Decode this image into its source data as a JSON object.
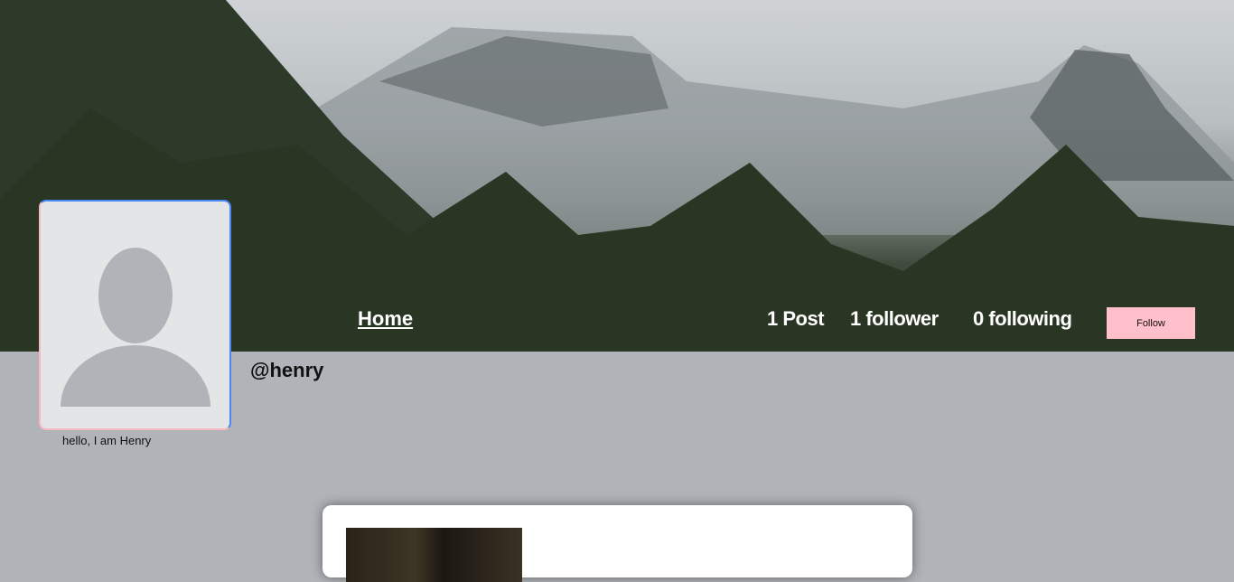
{
  "nav": {
    "home_label": "Home"
  },
  "stats": {
    "posts": "1 Post",
    "followers": "1 follower",
    "following": "0 following"
  },
  "follow_label": "Follow",
  "profile": {
    "handle": "@henry",
    "bio": "hello, I am Henry"
  },
  "colors": {
    "page_bg": "#b0b3b8",
    "follow_button": "#ffc0cb",
    "avatar_bg": "#e4e5e7"
  }
}
